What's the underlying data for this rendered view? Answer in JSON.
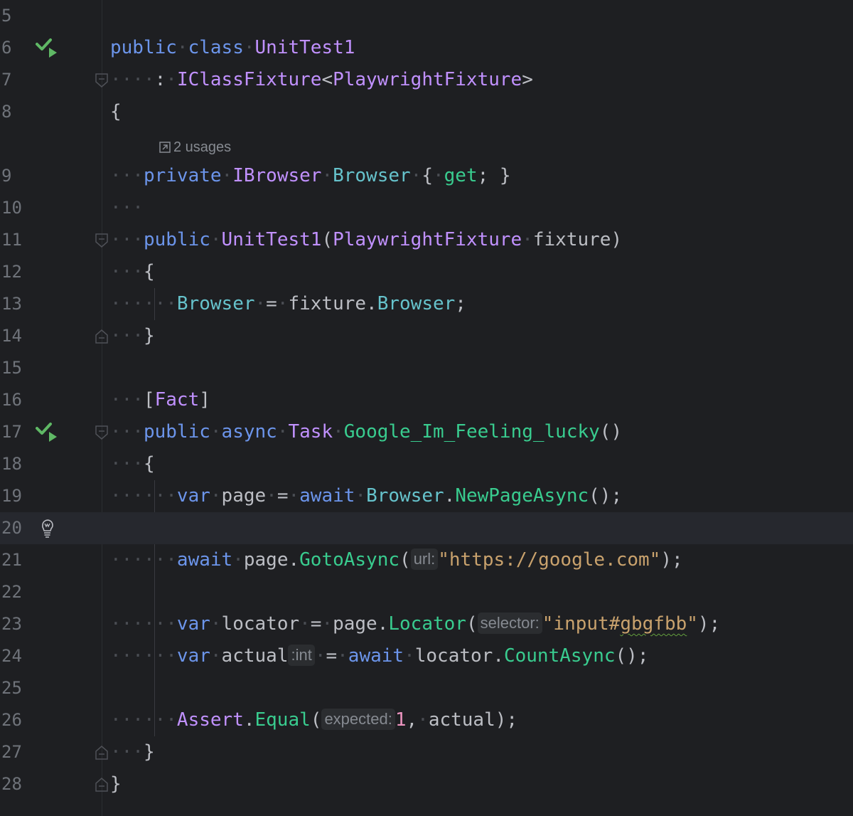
{
  "editor": {
    "lines": [
      {
        "n": "5"
      },
      {
        "n": "6",
        "gutter_icon": "run-test-passed-icon"
      },
      {
        "n": "7"
      },
      {
        "n": "8"
      },
      {
        "n": "9"
      },
      {
        "n": "10"
      },
      {
        "n": "11"
      },
      {
        "n": "12"
      },
      {
        "n": "13"
      },
      {
        "n": "14"
      },
      {
        "n": "15"
      },
      {
        "n": "16"
      },
      {
        "n": "17",
        "gutter_icon": "run-test-passed-icon"
      },
      {
        "n": "18"
      },
      {
        "n": "19"
      },
      {
        "n": "20",
        "gutter_icon": "lightbulb-icon",
        "current": true
      },
      {
        "n": "21"
      },
      {
        "n": "22"
      },
      {
        "n": "23"
      },
      {
        "n": "24"
      },
      {
        "n": "25"
      },
      {
        "n": "26"
      },
      {
        "n": "27"
      },
      {
        "n": "28"
      }
    ],
    "usages_hint": "2 usages",
    "code": {
      "l6": {
        "kw1": "public",
        "kw2": "class",
        "name": "UnitTest1"
      },
      "l7": {
        "colon": ":",
        "iface": "IClassFixture",
        "lt": "<",
        "generic": "PlaywrightFixture",
        "gt": ">"
      },
      "l8": {
        "brace": "{"
      },
      "l9": {
        "kw": "private",
        "type": "IBrowser",
        "prop": "Browser",
        "ob": "{",
        "get": "get",
        "semi_cb": "; }"
      },
      "l11": {
        "kw": "public",
        "ctor": "UnitTest1",
        "op": "(",
        "ptype": "PlaywrightFixture",
        "pname": "fixture",
        "cp": ")"
      },
      "l12": {
        "brace": "{"
      },
      "l13": {
        "prop": "Browser",
        "eq": "=",
        "obj": "fixture",
        "dot": ".",
        "prop2": "Browser",
        "semi": ";"
      },
      "l14": {
        "brace": "}"
      },
      "l16": {
        "ob": "[",
        "attr": "Fact",
        "cb": "]"
      },
      "l17": {
        "kw1": "public",
        "kw2": "async",
        "type": "Task",
        "method": "Google_Im_Feeling_lucky",
        "parens": "()"
      },
      "l18": {
        "brace": "{"
      },
      "l19": {
        "var": "var",
        "name": "page",
        "eq": "=",
        "await": "await",
        "obj": "Browser",
        "dot": ".",
        "method": "NewPageAsync",
        "end": "();"
      },
      "l21": {
        "await": "await",
        "obj": "page",
        "dot": ".",
        "method": "GotoAsync",
        "op": "(",
        "hint": "url:",
        "str": "\"https://google.com\"",
        "end": ");"
      },
      "l23": {
        "var": "var",
        "name": "locator",
        "eq": "=",
        "obj": "page",
        "dot": ".",
        "method": "Locator",
        "op": "(",
        "hint": "selector:",
        "str_a": "\"input#",
        "str_b": "gbgfbb",
        "str_c": "\"",
        "end": ");"
      },
      "l24": {
        "var": "var",
        "name": "actual",
        "hint": ":int",
        "eq": "=",
        "await": "await",
        "obj": "locator",
        "dot": ".",
        "method": "CountAsync",
        "end": "();"
      },
      "l26": {
        "cls": "Assert",
        "dot": ".",
        "method": "Equal",
        "op": "(",
        "hint": "expected:",
        "num": "1",
        "comma": ",",
        "arg": "actual",
        "end": ");"
      },
      "l27": {
        "brace": "}"
      },
      "l28": {
        "brace": "}"
      }
    }
  },
  "colors": {
    "background": "#1e1f22",
    "keyword": "#6c95eb",
    "type": "#c191ff",
    "method": "#39cc8f",
    "property": "#66c3cc",
    "string": "#c9a26d",
    "number": "#ed94c0",
    "text": "#bcbec4",
    "line_number": "#6f737a",
    "test_passed": "#5fb865"
  }
}
